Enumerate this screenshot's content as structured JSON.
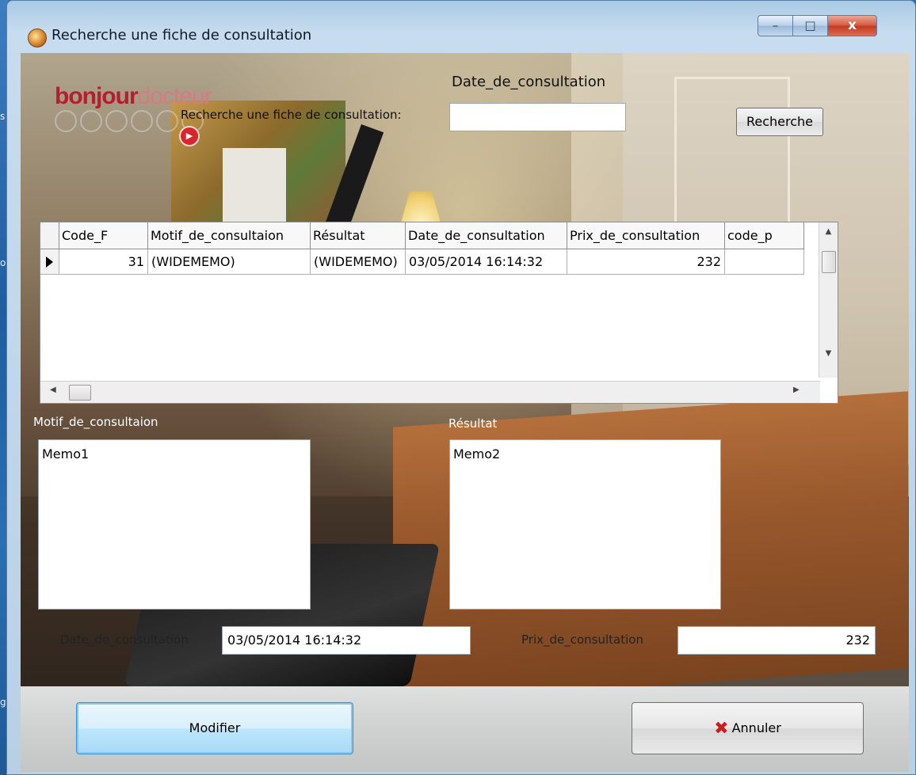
{
  "window": {
    "title": "Recherche une fiche de consultation",
    "controls": {
      "minimize": "–",
      "maximize": "□",
      "close": "x"
    }
  },
  "desktop": {
    "edge_labels": [
      "s",
      "o",
      "g"
    ]
  },
  "logo": {
    "bonjour": "bonjour",
    "docteur": "docteur"
  },
  "search": {
    "top_label": "Date_de_consultation",
    "label": "Recherche une fiche de consultation:",
    "value": "",
    "button_label": "Recherche"
  },
  "grid": {
    "columns": [
      "Code_F",
      "Motif_de_consultaion",
      "Résultat",
      "Date_de_consultation",
      "Prix_de_consultation",
      "code_p"
    ],
    "rows": [
      [
        "31",
        "(WIDEMEMO)",
        "(WIDEMEMO)",
        "03/05/2014 16:14:32",
        "232",
        ""
      ]
    ]
  },
  "form": {
    "motif_label": "Motif_de_consultaion",
    "resultat_label": "Résultat",
    "memo1": "Memo1",
    "memo2": "Memo2",
    "date_label": "Date_de_consultation",
    "date_value": "03/05/2014 16:14:32",
    "prix_label": "Prix_de_consultation",
    "prix_value": "232"
  },
  "footer": {
    "modifier_label": "Modifier",
    "annuler_label": "Annuler"
  },
  "colors": {
    "brand_red": "#b41e2e",
    "accent_blue": "#3c8fd1",
    "cancel_red": "#c81e1e"
  }
}
